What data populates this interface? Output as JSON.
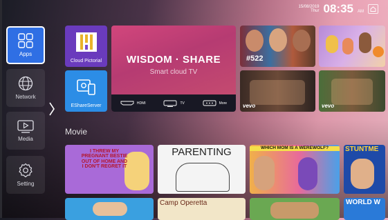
{
  "status": {
    "date": "15/08/2019",
    "day": "Thur",
    "time": "08:35",
    "ampm": "AM"
  },
  "sidebar": {
    "items": [
      {
        "label": "Apps",
        "icon": "apps-grid-icon"
      },
      {
        "label": "Network",
        "icon": "globe-icon"
      },
      {
        "label": "Media",
        "icon": "media-play-icon"
      },
      {
        "label": "Setting",
        "icon": "gear-icon"
      }
    ]
  },
  "apps": [
    {
      "label": "Cloud Pictorial",
      "icon": "cloud-pictorial-icon"
    },
    {
      "label": "EShareServer",
      "icon": "eshare-icon"
    }
  ],
  "banner": {
    "title": "WISDOM · SHARE",
    "subtitle": "Smart cloud TV",
    "inputs": [
      {
        "label": "HDMI",
        "icon": "hdmi-icon"
      },
      {
        "label": "TV",
        "icon": "tv-icon"
      },
      {
        "label": "More",
        "icon": "more-icon"
      }
    ]
  },
  "featured": [
    {
      "badge": "#522"
    },
    {
      "badge": ""
    },
    {
      "badge": "vevo"
    },
    {
      "badge": "vevo"
    }
  ],
  "movie_section": {
    "title": "Movie"
  },
  "movies": [
    {
      "text": "I THREW MY PREGNANT BESTIE OUT OF HOME AND I DON'T REGRET IT"
    },
    {
      "text": "PARENTING"
    },
    {
      "text": "WHICH MOM IS A WEREWOLF?"
    },
    {
      "text": "STUNTME"
    },
    {
      "text": ""
    },
    {
      "text": "Camp Operetta"
    },
    {
      "text": ""
    },
    {
      "text": "WORLD W"
    }
  ]
}
